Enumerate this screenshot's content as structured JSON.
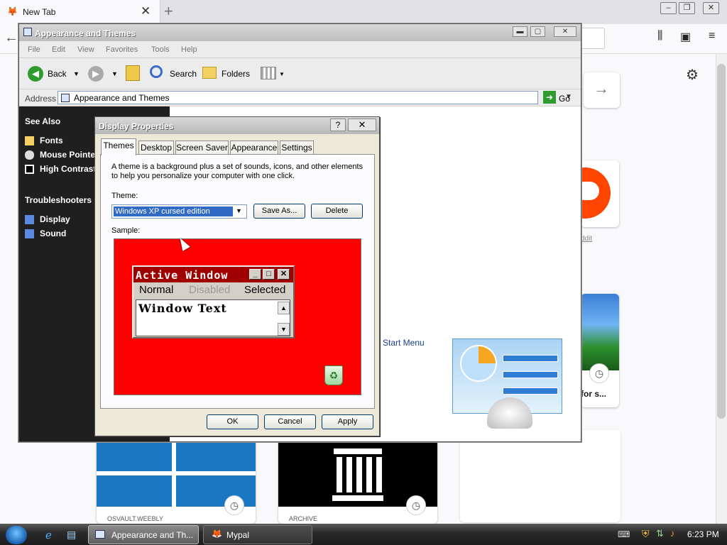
{
  "browser": {
    "tab_title": "New Tab",
    "tab_close": "✕",
    "new_tab": "+",
    "window_min": "–",
    "window_max": "❐",
    "window_close": "✕",
    "reddit_label": "ddit",
    "sonic_label": "for s...",
    "osvault_label": "OSVAULT.WEEBLY",
    "archive_label": "ARCHIVE"
  },
  "explorer": {
    "title": "Appearance and Themes",
    "menu": [
      "File",
      "Edit",
      "View",
      "Favorites",
      "Tools",
      "Help"
    ],
    "toolbar": {
      "back": "Back",
      "search": "Search",
      "folders": "Folders"
    },
    "address_label": "Address",
    "address_value": "Appearance and Themes",
    "go": "Go",
    "see_also": "See Also",
    "see_also_items": [
      "Fonts",
      "Mouse Pointer",
      "High Contrast"
    ],
    "troubleshooters": "Troubleshooters",
    "troubleshooter_items": [
      "Display",
      "Sound"
    ],
    "start_menu_link": "Start Menu"
  },
  "dialog": {
    "title": "Display Properties",
    "help_btn": "?",
    "close_btn": "✕",
    "tabs": [
      "Themes",
      "Desktop",
      "Screen Saver",
      "Appearance",
      "Settings"
    ],
    "active_tab": "Themes",
    "description": "A theme is a background plus a set of sounds, icons, and other elements to help you personalize your computer with one click.",
    "theme_label": "Theme:",
    "theme_value": "Windows XP cursed edition",
    "save_as": "Save As...",
    "delete": "Delete",
    "sample_label": "Sample:",
    "sample": {
      "active_window_title": "Active Window",
      "menu": [
        "Normal",
        "Disabled",
        "Selected"
      ],
      "window_text": "Window Text"
    },
    "buttons": {
      "ok": "OK",
      "cancel": "Cancel",
      "apply": "Apply"
    }
  },
  "taskbar": {
    "tasks": [
      "Appearance and Th...",
      "Mypal"
    ],
    "clock": "6:23 PM"
  },
  "colors": {
    "sample_background": "#ff0000",
    "active_title": "#a00000",
    "selected_item": "#316ac5"
  }
}
